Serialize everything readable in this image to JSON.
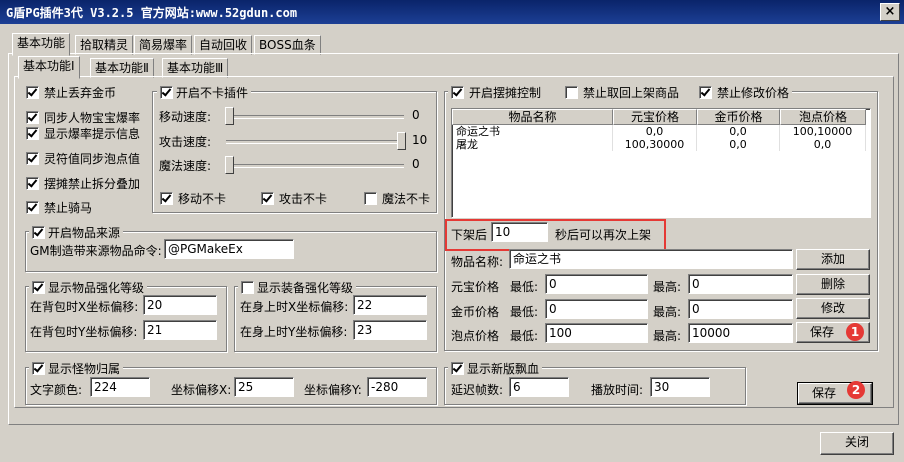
{
  "window": {
    "title": "G盾PG插件3代 V3.2.5  官方网站:www.52gdun.com",
    "close_glyph": "×"
  },
  "main_tabs": [
    "基本功能",
    "拾取精灵",
    "简易爆率",
    "自动回收",
    "BOSS血条"
  ],
  "sub_tabs": [
    "基本功能Ⅰ",
    "基本功能Ⅱ",
    "基本功能Ⅲ"
  ],
  "left_checks": [
    {
      "label": "禁止丢弃金币",
      "checked": true
    },
    {
      "label": "同步人物宝宝爆率",
      "checked": true
    },
    {
      "label": "显示爆率提示信息",
      "checked": true
    },
    {
      "label": "灵符值同步泡点值",
      "checked": true
    },
    {
      "label": "摆摊禁止拆分叠加",
      "checked": true
    },
    {
      "label": "禁止骑马",
      "checked": true
    }
  ],
  "speed_group": {
    "title": "开启不卡插件",
    "checked": true,
    "sliders": [
      {
        "label": "移动速度:",
        "value": "0",
        "fraction": 0.0
      },
      {
        "label": "攻击速度:",
        "value": "10",
        "fraction": 1.0
      },
      {
        "label": "魔法速度:",
        "value": "0",
        "fraction": 0.0
      }
    ],
    "checks": [
      {
        "label": "移动不卡",
        "checked": true
      },
      {
        "label": "攻击不卡",
        "checked": true
      },
      {
        "label": "魔法不卡",
        "checked": false
      }
    ]
  },
  "source_group": {
    "title": "开启物品来源",
    "checked": true,
    "label": "GM制造带来源物品命令:",
    "value": "@PGMakeEx"
  },
  "item_strength": {
    "title": "显示物品强化等级",
    "checked": true,
    "rows": [
      {
        "label": "在背包时X坐标偏移:",
        "value": "20"
      },
      {
        "label": "在背包时Y坐标偏移:",
        "value": "21"
      }
    ]
  },
  "equip_strength": {
    "title": "显示装备强化等级",
    "checked": false,
    "rows": [
      {
        "label": "在身上时X坐标偏移:",
        "value": "22"
      },
      {
        "label": "在身上时Y坐标偏移:",
        "value": "23"
      }
    ]
  },
  "monster_group": {
    "title": "显示怪物归属",
    "checked": true,
    "color_label": "文字颜色:",
    "color_value": "224",
    "x_label": "坐标偏移X:",
    "x_value": "25",
    "y_label": "坐标偏移Y:",
    "y_value": "-280"
  },
  "stall": {
    "checks": [
      {
        "label": "开启摆摊控制",
        "checked": true
      },
      {
        "label": "禁止取回上架商品",
        "checked": false
      },
      {
        "label": "禁止修改价格",
        "checked": true
      }
    ],
    "columns": [
      "物品名称",
      "元宝价格",
      "金币价格",
      "泡点价格"
    ],
    "rows": [
      [
        "命运之书",
        "0,0",
        "0,0",
        "100,10000"
      ],
      [
        "屠龙",
        "100,30000",
        "0,0",
        "0,0"
      ]
    ],
    "relist_prefix": "下架后",
    "relist_value": "10",
    "relist_suffix": "秒后可以再次上架",
    "name_label": "物品名称:",
    "name_value": "命运之书",
    "price_rows": [
      {
        "label": "元宝价格",
        "min_label": "最低:",
        "min": "0",
        "max_label": "最高:",
        "max": "0"
      },
      {
        "label": "金币价格",
        "min_label": "最低:",
        "min": "0",
        "max_label": "最高:",
        "max": "0"
      },
      {
        "label": "泡点价格",
        "min_label": "最低:",
        "min": "100",
        "max_label": "最高:",
        "max": "10000"
      }
    ],
    "buttons": {
      "add": "添加",
      "delete": "删除",
      "modify": "修改",
      "save": "保存"
    },
    "badge1": "1"
  },
  "float_group": {
    "title": "显示新版飘血",
    "checked": true,
    "delay_label": "延迟帧数:",
    "delay_value": "6",
    "play_label": "播放时间:",
    "play_value": "30"
  },
  "save_button": "保存",
  "badge2": "2",
  "close_button": "关闭"
}
